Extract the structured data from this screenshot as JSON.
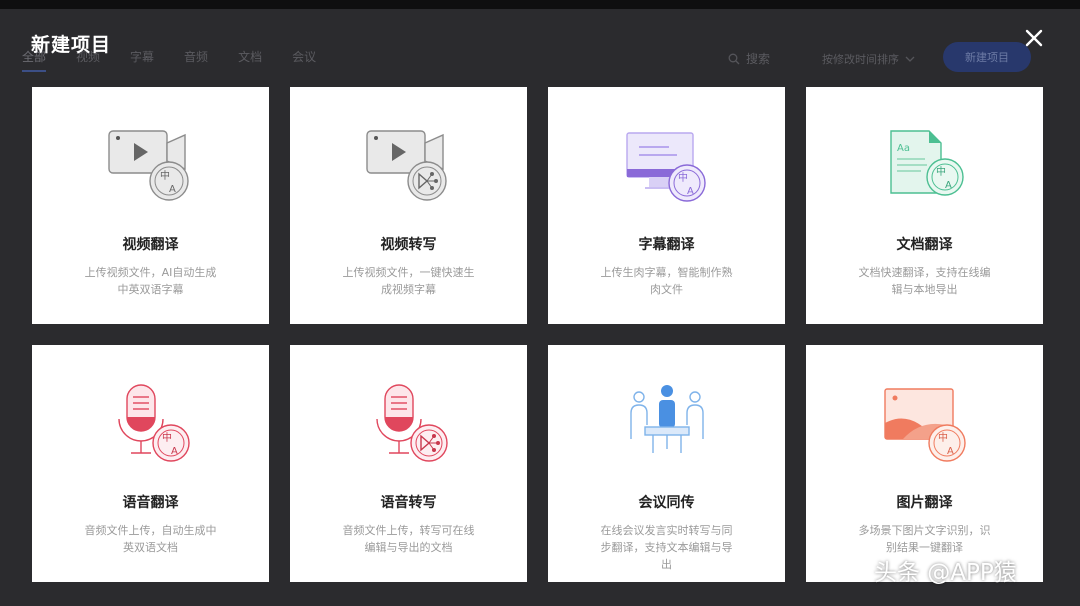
{
  "background": {
    "tabs": [
      "全部",
      "视频",
      "字幕",
      "音频",
      "文档",
      "会议"
    ],
    "search_label": "搜索",
    "sort_label": "按修改时间排序",
    "new_project_button": "新建项目"
  },
  "modal": {
    "title": "新建项目",
    "cards": [
      {
        "title": "视频翻译",
        "desc": "上传视频文件，AI自动生成中英双语字幕",
        "icon": "video-translate-icon"
      },
      {
        "title": "视频转写",
        "desc": "上传视频文件，一键快速生成视频字幕",
        "icon": "video-transcribe-icon"
      },
      {
        "title": "字幕翻译",
        "desc": "上传生肉字幕，智能制作熟肉文件",
        "icon": "subtitle-translate-icon"
      },
      {
        "title": "文档翻译",
        "desc": "文档快速翻译，支持在线编辑与本地导出",
        "icon": "document-translate-icon"
      },
      {
        "title": "语音翻译",
        "desc": "音频文件上传，自动生成中英双语文档",
        "icon": "audio-translate-icon"
      },
      {
        "title": "语音转写",
        "desc": "音频文件上传，转写可在线编辑与导出的文档",
        "icon": "audio-transcribe-icon"
      },
      {
        "title": "会议同传",
        "desc": "在线会议发言实时转写与同步翻译，支持文本编辑与导出",
        "icon": "meeting-interpret-icon"
      },
      {
        "title": "图片翻译",
        "desc": "多场景下图片文字识别，识别结果一键翻译",
        "icon": "image-translate-icon"
      }
    ]
  },
  "watermark": "头条 @APP猿",
  "colors": {
    "overlay": "#2b2b2e",
    "card": "#ffffff",
    "video_gray": "#8c8c8c",
    "subtitle_purple": "#8a6ad8",
    "document_green": "#4cbf92",
    "audio_red": "#e0475d",
    "meeting_blue": "#4a90e2",
    "image_coral": "#f07b5f"
  }
}
